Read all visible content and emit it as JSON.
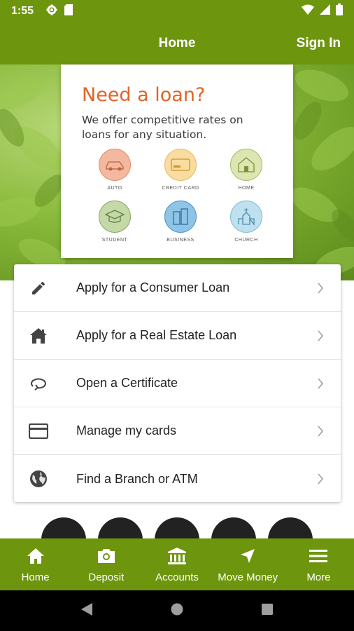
{
  "status_bar": {
    "time": "1:55"
  },
  "app_bar": {
    "title": "Home",
    "sign_in": "Sign In"
  },
  "loan_promo": {
    "title": "Need a loan?",
    "subtitle": "We offer competitive rates on loans for any situation.",
    "categories": [
      {
        "label": "AUTO",
        "color": "#f3b9a0",
        "icon": "car-icon"
      },
      {
        "label": "CREDIT CARD",
        "color": "#f9dca0",
        "icon": "credit-card-icon"
      },
      {
        "label": "HOME",
        "color": "#dbe6b2",
        "icon": "house-icon"
      },
      {
        "label": "STUDENT",
        "color": "#c5d9a8",
        "icon": "graduation-cap-icon"
      },
      {
        "label": "BUSINESS",
        "color": "#8fc4e6",
        "icon": "buildings-icon"
      },
      {
        "label": "CHURCH",
        "color": "#bfe0ee",
        "icon": "church-icon"
      }
    ]
  },
  "menu": {
    "items": [
      {
        "label": "Apply for a Consumer Loan",
        "icon": "pencil-icon"
      },
      {
        "label": "Apply for a Real Estate Loan",
        "icon": "house-icon"
      },
      {
        "label": "Open a Certificate",
        "icon": "refresh-icon"
      },
      {
        "label": "Manage my cards",
        "icon": "credit-card-icon"
      },
      {
        "label": "Find a Branch or ATM",
        "icon": "globe-icon"
      }
    ]
  },
  "bottom_nav": {
    "items": [
      {
        "label": "Home",
        "icon": "home-icon"
      },
      {
        "label": "Deposit",
        "icon": "camera-icon"
      },
      {
        "label": "Accounts",
        "icon": "bank-icon"
      },
      {
        "label": "Move Money",
        "icon": "navigation-arrow-icon"
      },
      {
        "label": "More",
        "icon": "hamburger-menu-icon"
      }
    ]
  },
  "colors": {
    "brand_green": "#6e950e",
    "promo_orange": "#e06428"
  }
}
